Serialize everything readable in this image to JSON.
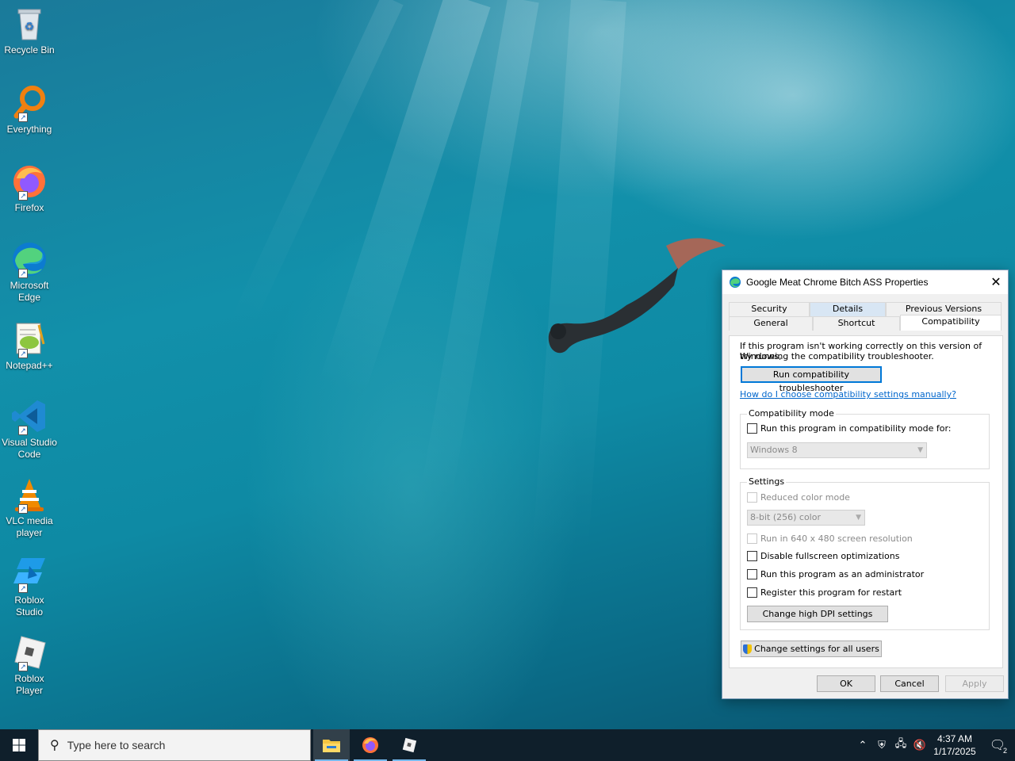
{
  "desktop": {
    "icons": [
      {
        "label": "Recycle Bin",
        "icon": "recycle-bin-icon"
      },
      {
        "label": "Everything",
        "icon": "everything-search-icon"
      },
      {
        "label": "Firefox",
        "icon": "firefox-icon"
      },
      {
        "label": "Microsoft Edge",
        "icon": "edge-icon"
      },
      {
        "label": "Notepad++",
        "icon": "notepad-plus-plus-icon"
      },
      {
        "label": "Visual Studio Code",
        "icon": "vscode-icon"
      },
      {
        "label": "VLC media player",
        "icon": "vlc-icon"
      },
      {
        "label": "Roblox Studio",
        "icon": "roblox-studio-icon"
      },
      {
        "label": "Roblox Player",
        "icon": "roblox-player-icon"
      }
    ]
  },
  "dialog": {
    "title": "Google Meat Chrome Bitch ASS Properties",
    "close_label": "✕",
    "tabs_row1": [
      "Security",
      "Details",
      "Previous Versions"
    ],
    "tabs_row2": [
      "General",
      "Shortcut",
      "Compatibility"
    ],
    "active_tab": "Compatibility",
    "intro_line1": "If this program isn't working correctly on this version of Windows,",
    "intro_line2": "try running the compatibility troubleshooter.",
    "troubleshooter_button": "Run compatibility troubleshooter",
    "help_link": "How do I choose compatibility settings manually?",
    "compat_group": {
      "label": "Compatibility mode",
      "checkbox_label": "Run this program in compatibility mode for:",
      "checked": false,
      "os_select_value": "Windows 8"
    },
    "settings_group": {
      "label": "Settings",
      "reduced_color": "Reduced color mode",
      "color_select_value": "8-bit (256) color",
      "resolution": "Run in 640 x 480 screen resolution",
      "fullscreen_opt": "Disable fullscreen optimizations",
      "run_admin": "Run this program as an administrator",
      "register_restart": "Register this program for restart",
      "dpi_button": "Change high DPI settings"
    },
    "all_users_button": "Change settings for all users",
    "ok_button": "OK",
    "cancel_button": "Cancel",
    "apply_button": "Apply"
  },
  "taskbar": {
    "search_placeholder": "Type here to search",
    "pinned": [
      "file-explorer-icon",
      "firefox-icon",
      "roblox-player-icon"
    ],
    "time": "4:37 AM",
    "date": "1/17/2025",
    "notification_count": "2"
  },
  "colors": {
    "accent": "#0078d7",
    "taskbar_bg": "#0f1f2b",
    "link": "#0066cc"
  }
}
